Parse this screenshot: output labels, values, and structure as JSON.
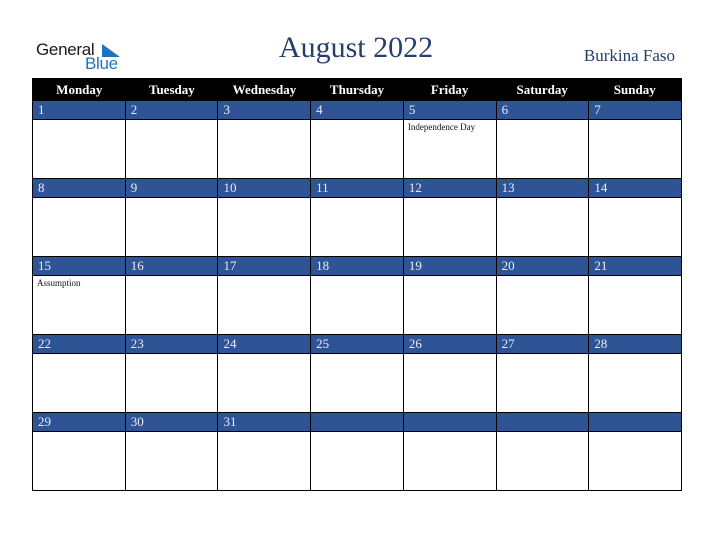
{
  "logo": {
    "line1": "General",
    "line2": "Blue"
  },
  "title": "August 2022",
  "country": "Burkina Faso",
  "colors": {
    "header_bg": "#000000",
    "day_bar": "#2e5496",
    "title": "#253e6e",
    "logo_blue": "#1e73be"
  },
  "weekdays": [
    "Monday",
    "Tuesday",
    "Wednesday",
    "Thursday",
    "Friday",
    "Saturday",
    "Sunday"
  ],
  "weeks": [
    [
      {
        "day": "1",
        "event": ""
      },
      {
        "day": "2",
        "event": ""
      },
      {
        "day": "3",
        "event": ""
      },
      {
        "day": "4",
        "event": ""
      },
      {
        "day": "5",
        "event": "Independence Day"
      },
      {
        "day": "6",
        "event": ""
      },
      {
        "day": "7",
        "event": ""
      }
    ],
    [
      {
        "day": "8",
        "event": ""
      },
      {
        "day": "9",
        "event": ""
      },
      {
        "day": "10",
        "event": ""
      },
      {
        "day": "11",
        "event": ""
      },
      {
        "day": "12",
        "event": ""
      },
      {
        "day": "13",
        "event": ""
      },
      {
        "day": "14",
        "event": ""
      }
    ],
    [
      {
        "day": "15",
        "event": "Assumption"
      },
      {
        "day": "16",
        "event": ""
      },
      {
        "day": "17",
        "event": ""
      },
      {
        "day": "18",
        "event": ""
      },
      {
        "day": "19",
        "event": ""
      },
      {
        "day": "20",
        "event": ""
      },
      {
        "day": "21",
        "event": ""
      }
    ],
    [
      {
        "day": "22",
        "event": ""
      },
      {
        "day": "23",
        "event": ""
      },
      {
        "day": "24",
        "event": ""
      },
      {
        "day": "25",
        "event": ""
      },
      {
        "day": "26",
        "event": ""
      },
      {
        "day": "27",
        "event": ""
      },
      {
        "day": "28",
        "event": ""
      }
    ],
    [
      {
        "day": "29",
        "event": ""
      },
      {
        "day": "30",
        "event": ""
      },
      {
        "day": "31",
        "event": ""
      },
      {
        "day": "",
        "event": ""
      },
      {
        "day": "",
        "event": ""
      },
      {
        "day": "",
        "event": ""
      },
      {
        "day": "",
        "event": ""
      }
    ]
  ]
}
